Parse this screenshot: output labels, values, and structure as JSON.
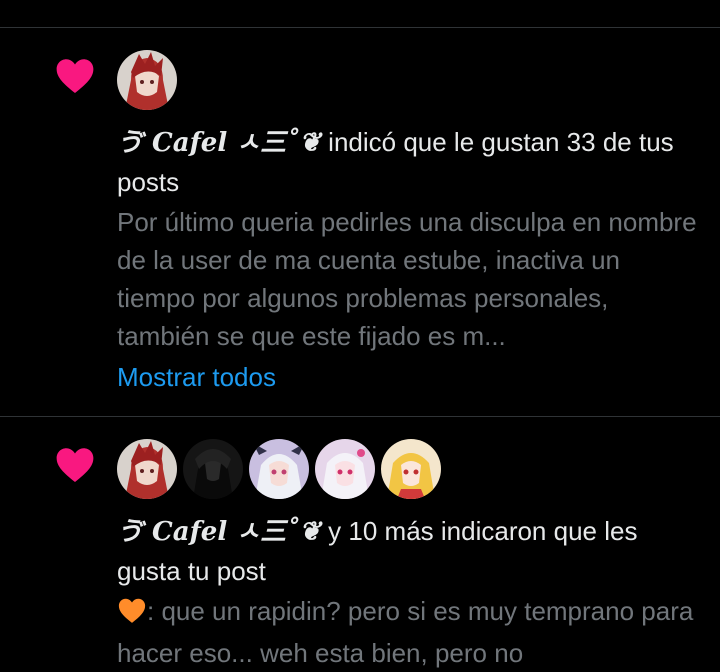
{
  "colors": {
    "background": "#000000",
    "divider": "#2f3336",
    "like_heart": "#f91880",
    "primary_text": "#e7e9ea",
    "secondary_text": "#71767b",
    "link": "#1d9bf0"
  },
  "notifications": [
    {
      "icon": "heart-icon",
      "avatars": [
        "avatar-red-hair-character"
      ],
      "actor_name": "ゔ Cafel ㅅ三˚❦",
      "action_text": " indicó que le gustan 33 de tus posts",
      "preview": "Por último queria pedirles una disculpa en nombre de la user de ma cuenta estube, inactiva un tiempo por algunos problemas personales, también se que este fijado es m...",
      "show_all_label": "Mostrar todos"
    },
    {
      "icon": "heart-icon",
      "avatars": [
        "avatar-red-hair-character",
        "avatar-dark-character",
        "avatar-white-hair-horns",
        "avatar-white-hair-pink",
        "avatar-blonde-character"
      ],
      "actor_name": "ゔ Cafel ㅅ三˚❦",
      "action_text": " y 10 más indicaron que les gusta tu post",
      "preview_emoji": "orange-heart-icon",
      "preview": ": que un rapidin? pero si es muy temprano para hacer eso... weh esta bien, pero no"
    }
  ]
}
